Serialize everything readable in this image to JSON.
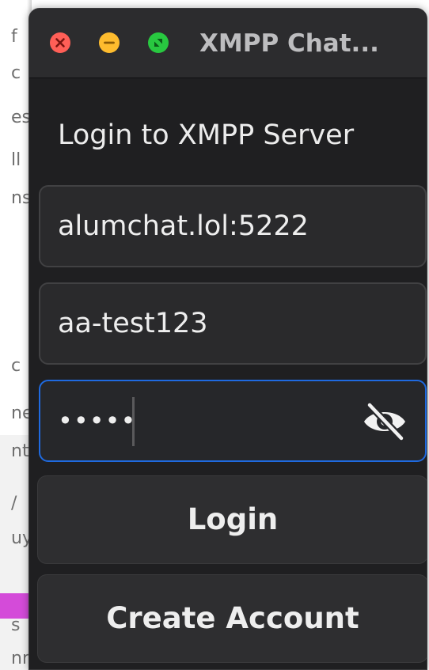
{
  "window": {
    "title": "XMPP Chat..."
  },
  "form": {
    "heading": "Login to XMPP Server",
    "server_value": "alumchat.lol:5222",
    "username_value": "aa-test123",
    "password_value": "•••••",
    "password_visibility_icon": "eye-slash-icon"
  },
  "buttons": {
    "login_label": "Login",
    "create_account_label": "Create Account"
  },
  "background": {
    "fragments": [
      "f",
      "c",
      "es",
      "ll",
      "ns",
      "c",
      "ne",
      "nt",
      "/",
      "uy",
      "s",
      "nr"
    ]
  },
  "colors": {
    "window_bg": "#1f1f21",
    "titlebar_bg": "#2c2c2e",
    "field_bg": "#2a2a2c",
    "focus_border": "#1f6ae0",
    "close": "#ff5f57",
    "minimize": "#febc2e",
    "zoom": "#28c840",
    "background_accent": "#d44bd9"
  }
}
